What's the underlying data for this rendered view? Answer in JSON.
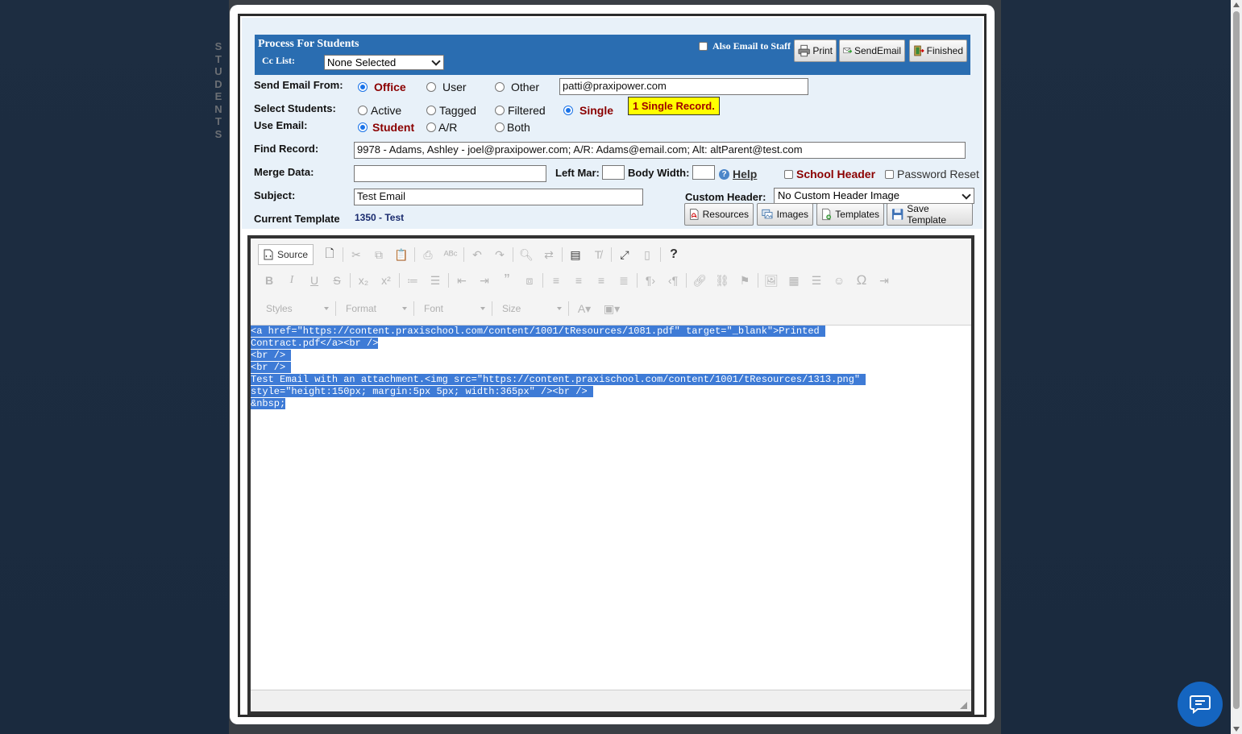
{
  "side_label": [
    "S",
    "T",
    "U",
    "D",
    "E",
    "N",
    "T",
    "S"
  ],
  "header": {
    "title": "Process For Students",
    "cc_label": "Cc List:",
    "cc_value": "None Selected",
    "also_email_staff": "Also Email to Staff",
    "print": "Print",
    "send_email": "SendEmail",
    "finished": "Finished"
  },
  "send_from": {
    "label": "Send Email From:",
    "options": [
      "Office",
      "User",
      "Other"
    ],
    "selected": "Office",
    "email": "patti@praxipower.com"
  },
  "select_students": {
    "label": "Select Students:",
    "options": [
      "Active",
      "Tagged",
      "Filtered",
      "Single"
    ],
    "selected": "Single",
    "badge": "1 Single Record."
  },
  "use_email": {
    "label": "Use Email:",
    "options": [
      "Student",
      "A/R",
      "Both"
    ],
    "selected": "Student"
  },
  "find_record": {
    "label": "Find Record:",
    "value": "9978 - Adams, Ashley - joel@praxipower.com; A/R: Adams@email.com; Alt: altParent@test.com"
  },
  "merge": {
    "label": "Merge Data:",
    "value": "",
    "left_mar_label": "Left Mar:",
    "body_width_label": "Body Width:",
    "help": "Help",
    "school_header": "School Header",
    "password_reset": "Password Reset"
  },
  "subject": {
    "label": "Subject:",
    "value": "Test Email",
    "custom_header_label": "Custom Header:",
    "custom_header_value": "No Custom Header Image"
  },
  "template": {
    "label": "Current Template",
    "value": "1350 - Test",
    "resources": "Resources",
    "images": "Images",
    "templates": "Templates",
    "save_template": "Save Template"
  },
  "editor": {
    "source_label": "Source",
    "styles": "Styles",
    "format": "Format",
    "font": "Font",
    "size": "Size",
    "lines": [
      "<a href=\"https://content.praxischool.com/content/1001/tResources/1081.pdf\" target=\"_blank\">Printed ",
      "Contract.pdf</a><br />",
      "<br /> ",
      "<br /> ",
      "Test Email with an attachment.<img src=\"https://content.praxischool.com/content/1001/tResources/1313.png\" ",
      "style=\"height:150px; margin:5px 5px; width:365px\" /><br /> ",
      "&nbsp;"
    ]
  },
  "colors": {
    "header_blue": "#2a6db1",
    "form_bg": "#e8f1f9",
    "selection": "#3e7bd6",
    "badge_yellow": "#ffff00",
    "chat_blue": "#1565c0"
  }
}
